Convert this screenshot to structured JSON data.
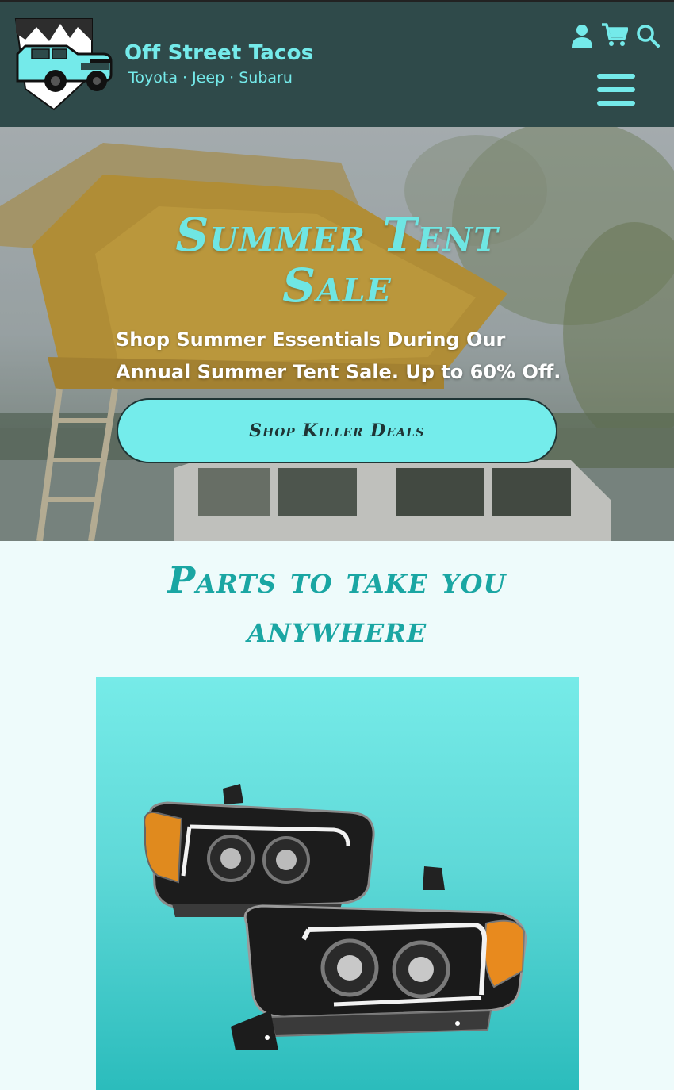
{
  "header": {
    "brand_name": "Off Street Tacos",
    "brand_tagline": "Toyota · Jeep · Subaru",
    "icons": [
      "account-icon",
      "cart-icon",
      "search-icon",
      "menu-icon"
    ]
  },
  "hero": {
    "title": "Summer Tent Sale",
    "subtitle": "Shop Summer Essentials During Our Annual Summer Tent Sale. Up to 60% Off.",
    "cta_label": "Shop Killer Deals"
  },
  "section": {
    "title": "Parts to take you anywhere"
  },
  "colors": {
    "header_bg": "#2f4a4a",
    "accent": "#74eaea",
    "section_title": "#1aa6a3",
    "page_bg": "#eefbfb"
  }
}
